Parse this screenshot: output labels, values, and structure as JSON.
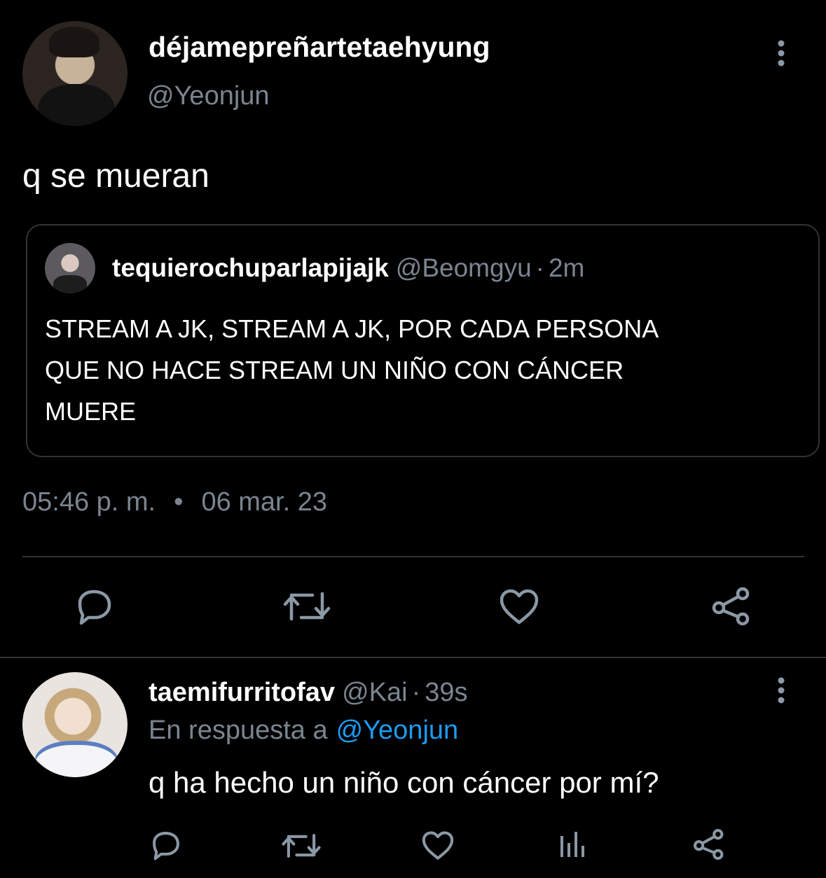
{
  "main_tweet": {
    "display_name": "déjamepreñartetaehyung",
    "handle": "@Yeonjun",
    "text": "q se mueran",
    "time": "05:46 p. m.",
    "separator": "•",
    "date": "06 mar. 23",
    "more_icon": "more-vertical-icon"
  },
  "quoted_tweet": {
    "display_name": "tequierochuparlapijajk",
    "handle": "@Beomgyu",
    "dot": "·",
    "time": "2m",
    "text": "STREAM A JK, STREAM A JK, POR CADA PERSONA\nQUE NO HACE STREAM UN NIÑO CON CÁNCER\nMUERE"
  },
  "main_actions": [
    "reply-icon",
    "retweet-icon",
    "like-icon",
    "share-icon"
  ],
  "reply_tweet": {
    "display_name": "taemifurritofav",
    "handle": "@Kai",
    "dot": "·",
    "time": "39s",
    "reply_to_label": "En respuesta a",
    "reply_to_handle": "@Yeonjun",
    "text": "q ha hecho un niño con cáncer por mí?",
    "more_icon": "more-vertical-icon"
  },
  "reply_actions": [
    "reply-icon",
    "retweet-icon",
    "like-icon",
    "analytics-icon",
    "share-icon"
  ],
  "colors": {
    "background": "#000000",
    "text": "#ffffff",
    "secondary_text": "#7b8490",
    "link": "#1d9bf0",
    "divider": "#2f3336",
    "icon": "#8b98a5"
  }
}
